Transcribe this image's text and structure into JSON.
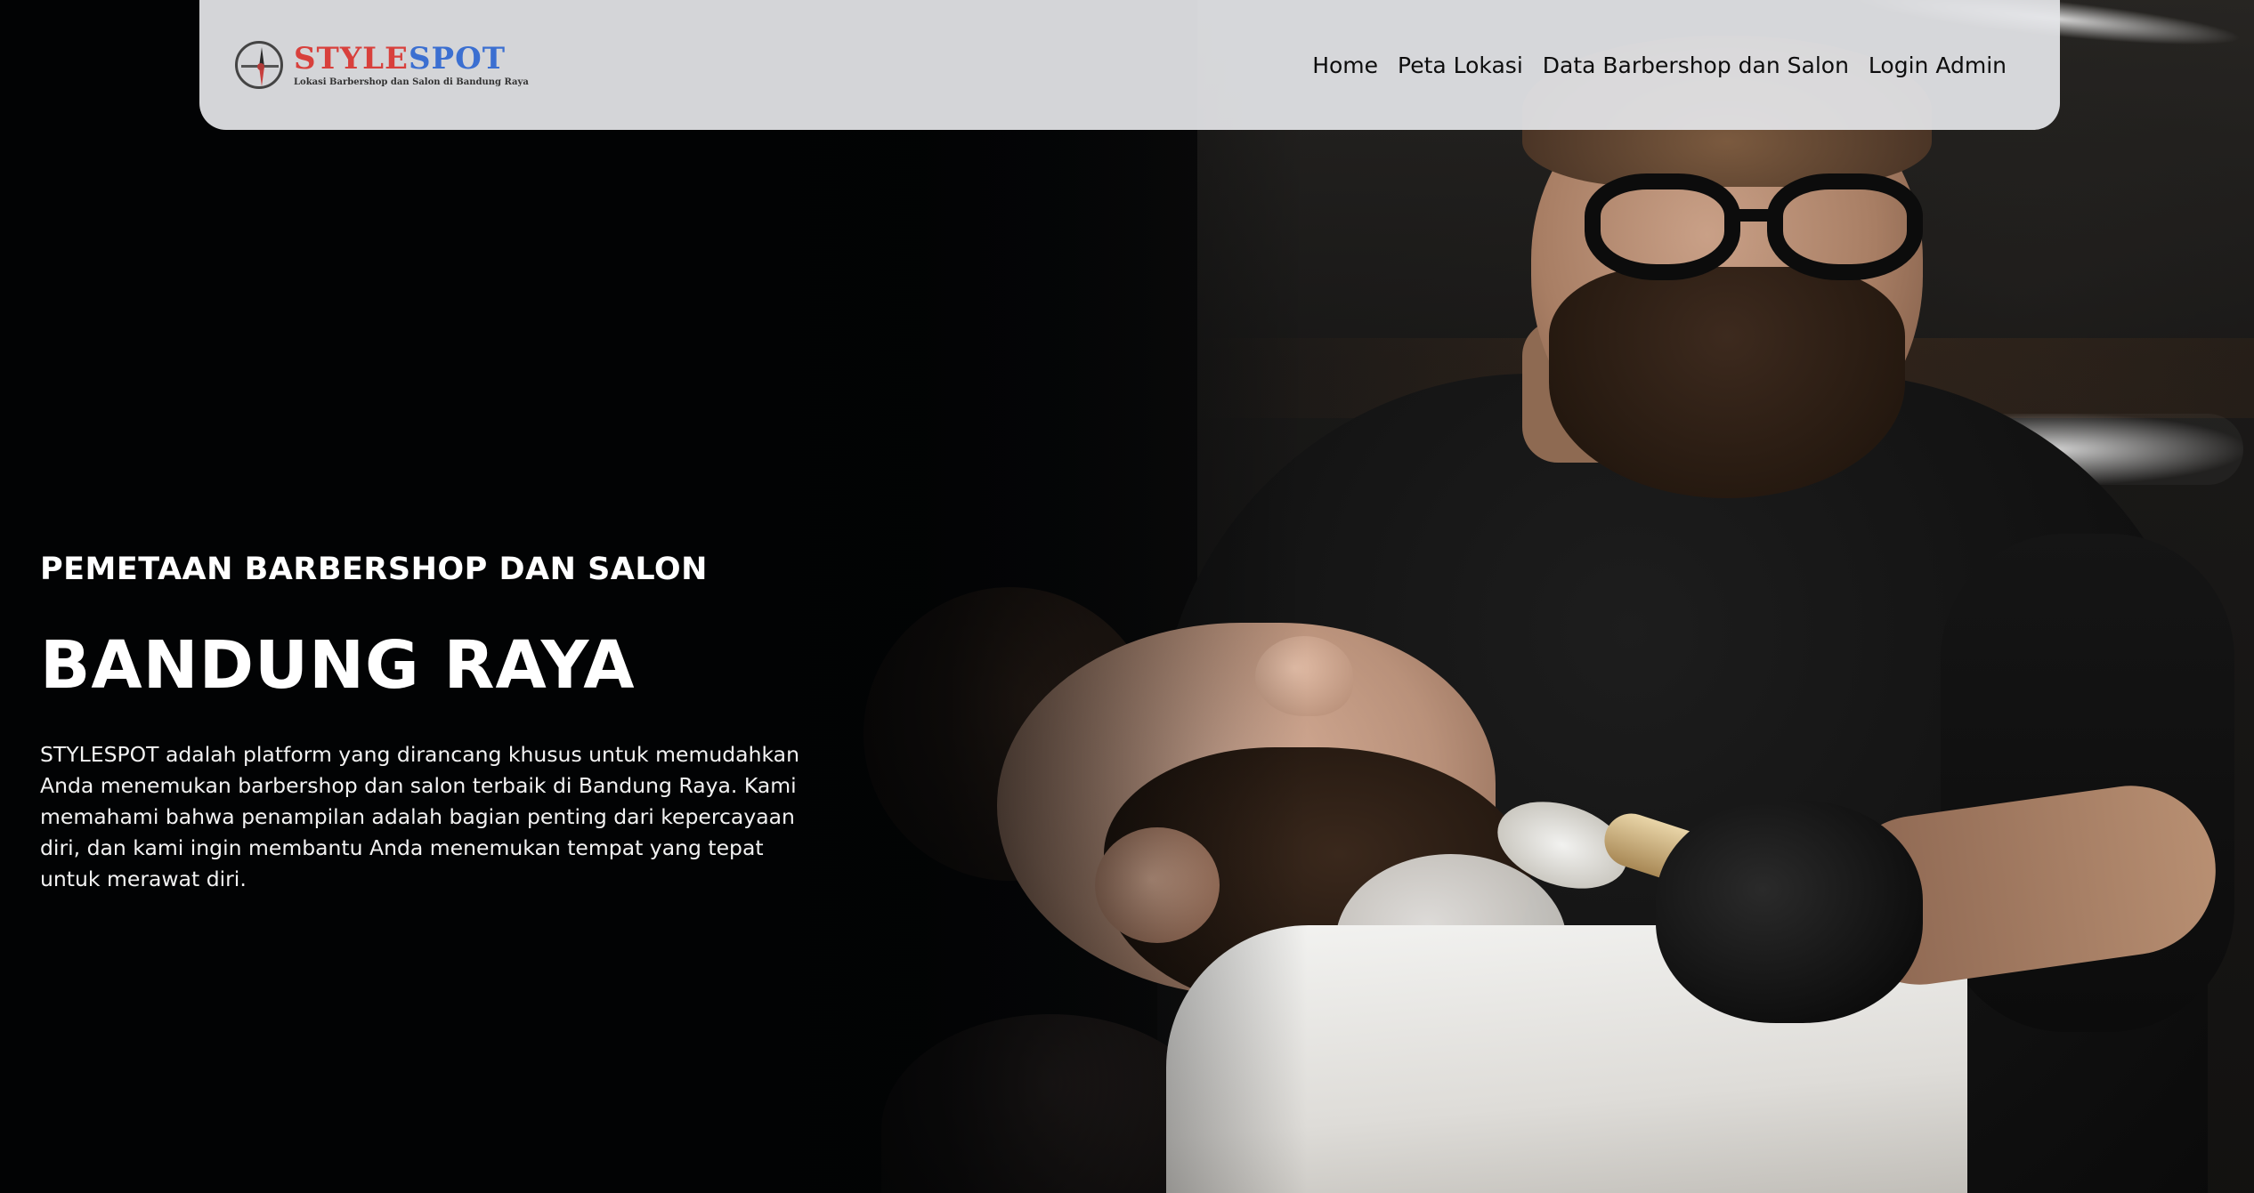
{
  "brand": {
    "name_part1": "STYLE",
    "name_part2": "SPOT",
    "tagline": "Lokasi Barbershop dan Salon di Bandung Raya",
    "logo_icon": "compass-icon",
    "colors": {
      "style": "#d8403c",
      "spot": "#3b6fd1"
    }
  },
  "nav": {
    "items": [
      {
        "label": "Home"
      },
      {
        "label": "Peta Lokasi"
      },
      {
        "label": "Data Barbershop dan Salon"
      },
      {
        "label": "Login Admin"
      }
    ]
  },
  "hero": {
    "kicker": "PEMETAAN BARBERSHOP DAN SALON",
    "title": "BANDUNG RAYA",
    "description": "STYLESPOT adalah platform yang dirancang khusus untuk memudahkan Anda menemukan barbershop dan salon terbaik di Bandung Raya. Kami memahami bahwa penampilan adalah bagian penting dari kepercayaan diri, dan kami ingin membantu Anda menemukan tempat yang tepat untuk merawat diri."
  }
}
